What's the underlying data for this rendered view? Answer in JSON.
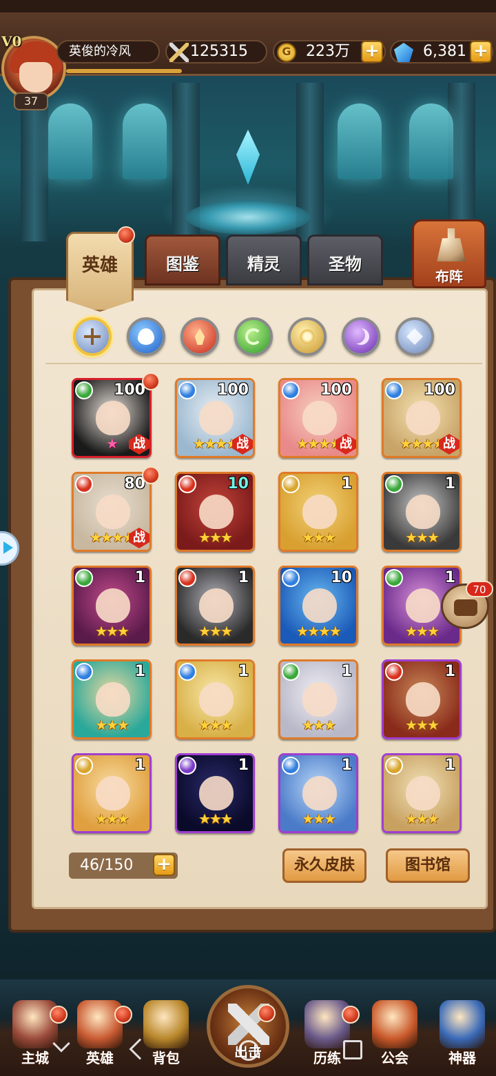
{
  "player": {
    "vip": "V0",
    "name": "英俊的冷风",
    "level": "37",
    "power": "125315",
    "gold": "223万",
    "gems": "6,381",
    "xp_fraction": 0.24
  },
  "tabs": [
    {
      "label": "英雄",
      "active": true,
      "badge": true
    },
    {
      "label": "图鉴",
      "active": false
    },
    {
      "label": "精灵",
      "active": false
    },
    {
      "label": "圣物",
      "active": false
    }
  ],
  "formation": {
    "label": "布阵",
    "icon": "chess-pieces-icon"
  },
  "elements": [
    {
      "name": "all-icon",
      "selected": true
    },
    {
      "name": "water-drop-icon"
    },
    {
      "name": "fire-icon"
    },
    {
      "name": "wind-icon"
    },
    {
      "name": "light-sun-icon"
    },
    {
      "name": "dark-moon-icon"
    },
    {
      "name": "neutral-crystal-icon"
    }
  ],
  "heroes": [
    {
      "level": "100",
      "element": "wind",
      "stars": "★",
      "star_color": "pink",
      "rarity": "red",
      "battle": "战",
      "badge": true,
      "art": [
        "#1a1a1a",
        "#e8e0d8"
      ]
    },
    {
      "level": "100",
      "element": "water",
      "stars": "★★★★",
      "rarity": "orange",
      "battle": "战",
      "art": [
        "#9bb8cf",
        "#e8eef4"
      ]
    },
    {
      "level": "100",
      "element": "water",
      "stars": "★★★★",
      "rarity": "orange",
      "battle": "战",
      "art": [
        "#e98a8a",
        "#f6cfc0"
      ]
    },
    {
      "level": "100",
      "element": "water",
      "stars": "★★★★",
      "rarity": "orange",
      "battle": "战",
      "art": [
        "#c8a468",
        "#f5e2b2"
      ]
    },
    {
      "level": "80",
      "element": "fire",
      "stars": "★★★★",
      "rarity": "orange",
      "battle": "战",
      "badge": true,
      "art": [
        "#c8b8a0",
        "#e8ded0"
      ]
    },
    {
      "level": "10",
      "level_color": "cyan",
      "element": "fire",
      "stars": "★★★",
      "rarity": "orange",
      "art": [
        "#7a1a1a",
        "#c4443a"
      ]
    },
    {
      "level": "1",
      "element": "light",
      "stars": "★★★",
      "rarity": "orange",
      "art": [
        "#d8a030",
        "#f3d27a"
      ]
    },
    {
      "level": "1",
      "element": "wind",
      "stars": "★★★",
      "rarity": "orange",
      "art": [
        "#3a3a3a",
        "#c8c8c8"
      ]
    },
    {
      "level": "1",
      "element": "wind",
      "stars": "★★★",
      "rarity": "orange",
      "art": [
        "#5a1a4a",
        "#c04a8a"
      ]
    },
    {
      "level": "1",
      "element": "fire",
      "stars": "★★★",
      "rarity": "orange",
      "art": [
        "#2a2a2a",
        "#b0b0b8"
      ]
    },
    {
      "level": "10",
      "element": "water",
      "stars": "★★★★",
      "rarity": "orange",
      "art": [
        "#1a5ab8",
        "#6ab8f0"
      ]
    },
    {
      "level": "1",
      "element": "wind",
      "stars": "★★★",
      "rarity": "orange",
      "art": [
        "#6a2a8a",
        "#d890d8"
      ]
    },
    {
      "level": "1",
      "element": "water",
      "stars": "★★★",
      "rarity": "orange",
      "art": [
        "#2aa89a",
        "#e8d8a0"
      ]
    },
    {
      "level": "1",
      "element": "water",
      "stars": "★★★",
      "rarity": "orange",
      "art": [
        "#d8b048",
        "#f8e8a8"
      ]
    },
    {
      "level": "1",
      "element": "wind",
      "stars": "★★★",
      "rarity": "orange",
      "art": [
        "#b8b8c8",
        "#f0eef4"
      ]
    },
    {
      "level": "1",
      "element": "fire",
      "stars": "★★★",
      "rarity": "purple",
      "art": [
        "#8a2a1a",
        "#c88a58"
      ]
    },
    {
      "level": "1",
      "element": "light",
      "stars": "★★★",
      "rarity": "purple",
      "art": [
        "#e0a040",
        "#f8dca0"
      ]
    },
    {
      "level": "1",
      "element": "dark",
      "stars": "★★★",
      "rarity": "purple",
      "art": [
        "#0a0a2a",
        "#2a2a6a"
      ]
    },
    {
      "level": "1",
      "element": "water",
      "stars": "★★★",
      "rarity": "purple",
      "art": [
        "#4a7ac8",
        "#b8d8f8"
      ]
    },
    {
      "level": "1",
      "element": "light",
      "stars": "★★★",
      "rarity": "purple",
      "art": [
        "#c8a060",
        "#f0e2b8"
      ]
    }
  ],
  "collection": {
    "count": "46/150"
  },
  "buttons": {
    "skins": "永久皮肤",
    "library": "图书馆"
  },
  "chat": {
    "count": "70"
  },
  "nav": [
    {
      "label": "主城",
      "icon": "castle-icon",
      "badge": true,
      "art": "#9a4a3a"
    },
    {
      "label": "英雄",
      "icon": "hero-portrait-icon",
      "badge": true,
      "art": "#c85a32"
    },
    {
      "label": "背包",
      "icon": "treasure-chest-icon",
      "badge": false,
      "art": "#b8862a"
    },
    {
      "label": "出击",
      "icon": "crossed-swords-icon",
      "badge": true,
      "center": true
    },
    {
      "label": "历练",
      "icon": "tower-icon",
      "badge": true,
      "art": "#6a5a8a"
    },
    {
      "label": "公会",
      "icon": "guild-shield-icon",
      "badge": false,
      "art": "#c8582a"
    },
    {
      "label": "神器",
      "icon": "artifact-gem-icon",
      "badge": false,
      "art": "#3a6ab8"
    }
  ],
  "colors": {
    "water": "#2f7fe0",
    "fire": "#d8321e",
    "wind": "#3aa83a",
    "light": "#d9a52a",
    "dark": "#7a3ac8",
    "orange_frame": "#e07a28",
    "red_frame": "#d81f2a",
    "purple_frame": "#a03ed0"
  }
}
